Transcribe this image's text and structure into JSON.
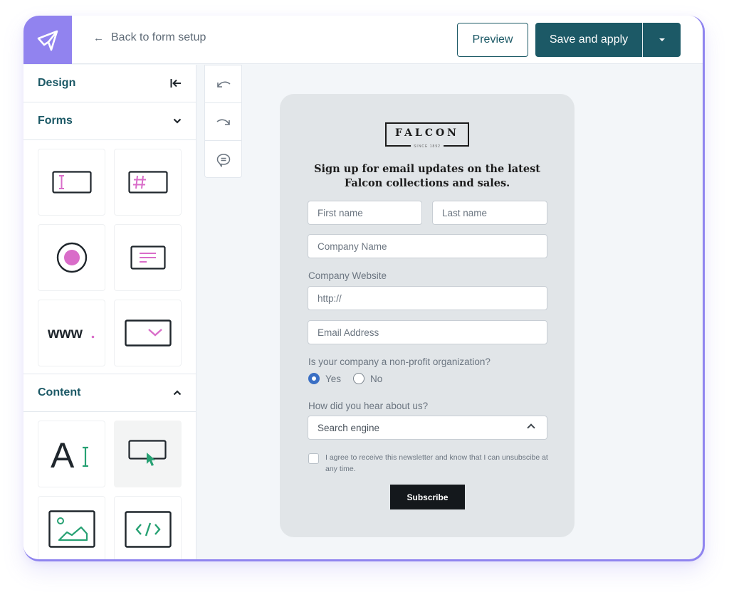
{
  "topbar": {
    "back_label": "Back to form setup",
    "preview_label": "Preview",
    "save_label": "Save and apply"
  },
  "sidebar": {
    "design_title": "Design",
    "forms_title": "Forms",
    "content_title": "Content",
    "form_tiles": [
      {
        "icon": "text-field-icon"
      },
      {
        "icon": "number-field-icon"
      },
      {
        "icon": "radio-button-icon"
      },
      {
        "icon": "text-area-icon"
      },
      {
        "icon": "url-field-icon",
        "glyph": "www"
      },
      {
        "icon": "dropdown-field-icon"
      }
    ],
    "content_tiles": [
      {
        "icon": "text-block-icon",
        "glyph": "A"
      },
      {
        "icon": "button-block-icon",
        "active": true
      },
      {
        "icon": "image-block-icon"
      },
      {
        "icon": "html-block-icon"
      }
    ]
  },
  "toolbar": {
    "items": [
      "undo-icon",
      "redo-icon",
      "comment-icon"
    ]
  },
  "form": {
    "brand_name": "FALCON",
    "brand_since": "SINCE 1892",
    "headline": "Sign up for email updates on the latest Falcon collections and sales.",
    "first_name_placeholder": "First name",
    "last_name_placeholder": "Last name",
    "company_name_placeholder": "Company Name",
    "website_label": "Company Website",
    "website_value": "http://",
    "email_placeholder": "Email Address",
    "nonprofit_question": "Is your company a non-profit organization?",
    "nonprofit_options": [
      "Yes",
      "No"
    ],
    "nonprofit_selected": "Yes",
    "source_question": "How did you hear about us?",
    "source_selected": "Search engine",
    "consent_text": "I agree to receive this newsletter and know that I can unsubscibe at any time.",
    "consent_checked": false,
    "subscribe_label": "Subscribe"
  },
  "colors": {
    "brand_purple": "#9183ef",
    "primary_teal": "#1c5966",
    "accent_pink": "#d96dc9",
    "accent_green": "#27a173",
    "radio_blue": "#3a6fc4"
  }
}
